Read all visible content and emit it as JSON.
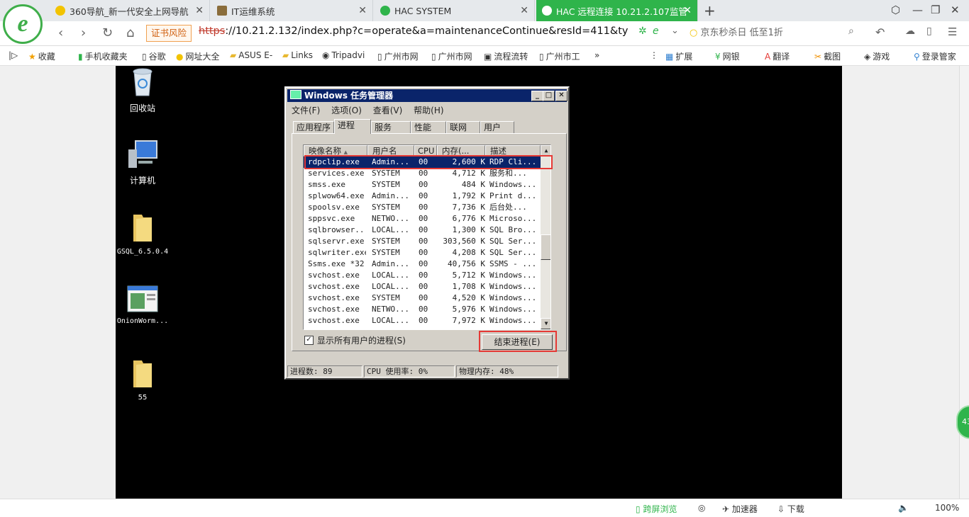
{
  "browser": {
    "tabs": [
      {
        "label": "360导航_新一代安全上网导航",
        "active": false
      },
      {
        "label": "IT运维系统",
        "active": false
      },
      {
        "label": "HAC SYSTEM",
        "active": false
      },
      {
        "label": "HAC 远程连接 10.21.2.107监管",
        "active": true
      }
    ],
    "new_tab": "+",
    "cert_warning": "证书风险",
    "url_scheme": "https",
    "url_rest": "://10.21.2.132/index.php?c=operate&a=maintenanceContinue&resId=411&ty",
    "search_text": "京东秒杀日 低至1折",
    "bookmarks": [
      "收藏",
      "手机收藏夹",
      "谷歌",
      "网址大全",
      "ASUS E-",
      "Links",
      "Tripadvi",
      "广州市网",
      "广州市网",
      "流程流转",
      "广州市工",
      "»"
    ],
    "extensions": [
      "扩展",
      "网银",
      "翻译",
      "截图",
      "游戏",
      "登录管家"
    ]
  },
  "desktop": {
    "icons": [
      "回收站",
      "计算机",
      "GSQL_6.5.0.4",
      "OnionWorm...",
      "55"
    ]
  },
  "taskmgr": {
    "title": "Windows 任务管理器",
    "menu": [
      "文件(F)",
      "选项(O)",
      "查看(V)",
      "帮助(H)"
    ],
    "tabs": [
      "应用程序",
      "进程",
      "服务",
      "性能",
      "联网",
      "用户"
    ],
    "selected_tab": "进程",
    "columns": [
      "映像名称",
      "用户名",
      "CPU",
      "内存(...",
      "描述"
    ],
    "rows": [
      [
        "rdpclip.exe",
        "Admin...",
        "00",
        "2,600 K",
        "RDP Cli..."
      ],
      [
        "services.exe",
        "SYSTEM",
        "00",
        "4,712 K",
        "服务和..."
      ],
      [
        "smss.exe",
        "SYSTEM",
        "00",
        "484 K",
        "Windows..."
      ],
      [
        "splwow64.exe",
        "Admin...",
        "00",
        "1,792 K",
        "Print d..."
      ],
      [
        "spoolsv.exe",
        "SYSTEM",
        "00",
        "7,736 K",
        "后台处..."
      ],
      [
        "sppsvc.exe",
        "NETWO...",
        "00",
        "6,776 K",
        "Microso..."
      ],
      [
        "sqlbrowser...",
        "LOCAL...",
        "00",
        "1,300 K",
        "SQL Bro..."
      ],
      [
        "sqlservr.exe",
        "SYSTEM",
        "00",
        "303,560 K",
        "SQL Ser..."
      ],
      [
        "sqlwriter.exe",
        "SYSTEM",
        "00",
        "4,208 K",
        "SQL Ser..."
      ],
      [
        "Ssms.exe *32",
        "Admin...",
        "00",
        "40,756 K",
        "SSMS - ..."
      ],
      [
        "svchost.exe",
        "LOCAL...",
        "00",
        "5,712 K",
        "Windows..."
      ],
      [
        "svchost.exe",
        "LOCAL...",
        "00",
        "1,708 K",
        "Windows..."
      ],
      [
        "svchost.exe",
        "SYSTEM",
        "00",
        "4,520 K",
        "Windows..."
      ],
      [
        "svchost.exe",
        "NETWO...",
        "00",
        "5,976 K",
        "Windows..."
      ],
      [
        "svchost.exe",
        "LOCAL...",
        "00",
        "7,972 K",
        "Windows..."
      ]
    ],
    "selected_row": 0,
    "show_all_label": "显示所有用户的进程(S)",
    "end_process_label": "结束进程(E)",
    "status": {
      "processes": "进程数: 89",
      "cpu": "CPU 使用率: 0%",
      "memory": "物理内存: 48%"
    }
  },
  "bottom_bar": {
    "items": [
      "跨屏浏览",
      "加速器",
      "下载",
      "100%"
    ]
  },
  "colors": {
    "accent_green": "#2fb44b",
    "title_blue": "#0a246a",
    "highlight_red": "#e53935"
  }
}
